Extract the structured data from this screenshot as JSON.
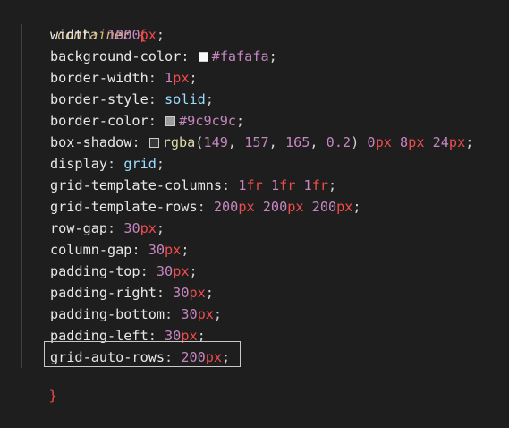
{
  "code": {
    "selector": ".container",
    "open_brace": "{",
    "close_brace": "}",
    "lines": [
      {
        "prop": "width",
        "parts": [
          {
            "t": "1000",
            "c": "num-purple"
          },
          {
            "t": "px",
            "c": "unit"
          }
        ]
      },
      {
        "prop": "background-color",
        "swatch": "#fafafa",
        "parts": [
          {
            "t": "#fafafa",
            "c": "hex"
          }
        ]
      },
      {
        "prop": "border-width",
        "parts": [
          {
            "t": "1",
            "c": "num-purple"
          },
          {
            "t": "px",
            "c": "unit"
          }
        ]
      },
      {
        "prop": "border-style",
        "parts": [
          {
            "t": "solid",
            "c": "kw"
          }
        ]
      },
      {
        "prop": "border-color",
        "swatch": "#9c9c9c",
        "parts": [
          {
            "t": "#9c9c9c",
            "c": "hex"
          }
        ]
      },
      {
        "prop": "box-shadow",
        "swatch": "rgba(149, 157, 165, 0.2)",
        "parts": [
          {
            "t": "rgba",
            "c": "func"
          },
          {
            "t": "(",
            "c": "paren"
          },
          {
            "t": "149",
            "c": "num-purple"
          },
          {
            "t": ", ",
            "c": "punct"
          },
          {
            "t": "157",
            "c": "num-purple"
          },
          {
            "t": ", ",
            "c": "punct"
          },
          {
            "t": "165",
            "c": "num-purple"
          },
          {
            "t": ", ",
            "c": "punct"
          },
          {
            "t": "0.2",
            "c": "num-purple"
          },
          {
            "t": ") ",
            "c": "paren"
          },
          {
            "t": "0",
            "c": "num-purple"
          },
          {
            "t": "px",
            "c": "unit"
          },
          {
            "t": " ",
            "c": "punct"
          },
          {
            "t": "8",
            "c": "num-purple"
          },
          {
            "t": "px",
            "c": "unit"
          },
          {
            "t": " ",
            "c": "punct"
          },
          {
            "t": "24",
            "c": "num-purple"
          },
          {
            "t": "px",
            "c": "unit"
          }
        ]
      },
      {
        "prop": "display",
        "parts": [
          {
            "t": "grid",
            "c": "kw"
          }
        ]
      },
      {
        "prop": "grid-template-columns",
        "parts": [
          {
            "t": "1",
            "c": "num-purple"
          },
          {
            "t": "fr",
            "c": "unit"
          },
          {
            "t": " ",
            "c": "punct"
          },
          {
            "t": "1",
            "c": "num-purple"
          },
          {
            "t": "fr",
            "c": "unit"
          },
          {
            "t": " ",
            "c": "punct"
          },
          {
            "t": "1",
            "c": "num-purple"
          },
          {
            "t": "fr",
            "c": "unit"
          }
        ]
      },
      {
        "prop": "grid-template-rows",
        "parts": [
          {
            "t": "200",
            "c": "num-purple"
          },
          {
            "t": "px",
            "c": "unit"
          },
          {
            "t": " ",
            "c": "punct"
          },
          {
            "t": "200",
            "c": "num-purple"
          },
          {
            "t": "px",
            "c": "unit"
          },
          {
            "t": " ",
            "c": "punct"
          },
          {
            "t": "200",
            "c": "num-purple"
          },
          {
            "t": "px",
            "c": "unit"
          }
        ]
      },
      {
        "prop": "row-gap",
        "parts": [
          {
            "t": "30",
            "c": "num-purple"
          },
          {
            "t": "px",
            "c": "unit"
          }
        ]
      },
      {
        "prop": "column-gap",
        "parts": [
          {
            "t": "30",
            "c": "num-purple"
          },
          {
            "t": "px",
            "c": "unit"
          }
        ]
      },
      {
        "prop": "padding-top",
        "parts": [
          {
            "t": "30",
            "c": "num-purple"
          },
          {
            "t": "px",
            "c": "unit"
          }
        ]
      },
      {
        "prop": "padding-right",
        "parts": [
          {
            "t": "30",
            "c": "num-purple"
          },
          {
            "t": "px",
            "c": "unit"
          }
        ]
      },
      {
        "prop": "padding-bottom",
        "parts": [
          {
            "t": "30",
            "c": "num-purple"
          },
          {
            "t": "px",
            "c": "unit"
          }
        ]
      },
      {
        "prop": "padding-left",
        "parts": [
          {
            "t": "30",
            "c": "num-purple"
          },
          {
            "t": "px",
            "c": "unit"
          }
        ]
      },
      {
        "prop": "grid-auto-rows",
        "highlighted": true,
        "parts": [
          {
            "t": "200",
            "c": "num-purple"
          },
          {
            "t": "px",
            "c": "unit"
          }
        ]
      }
    ]
  }
}
